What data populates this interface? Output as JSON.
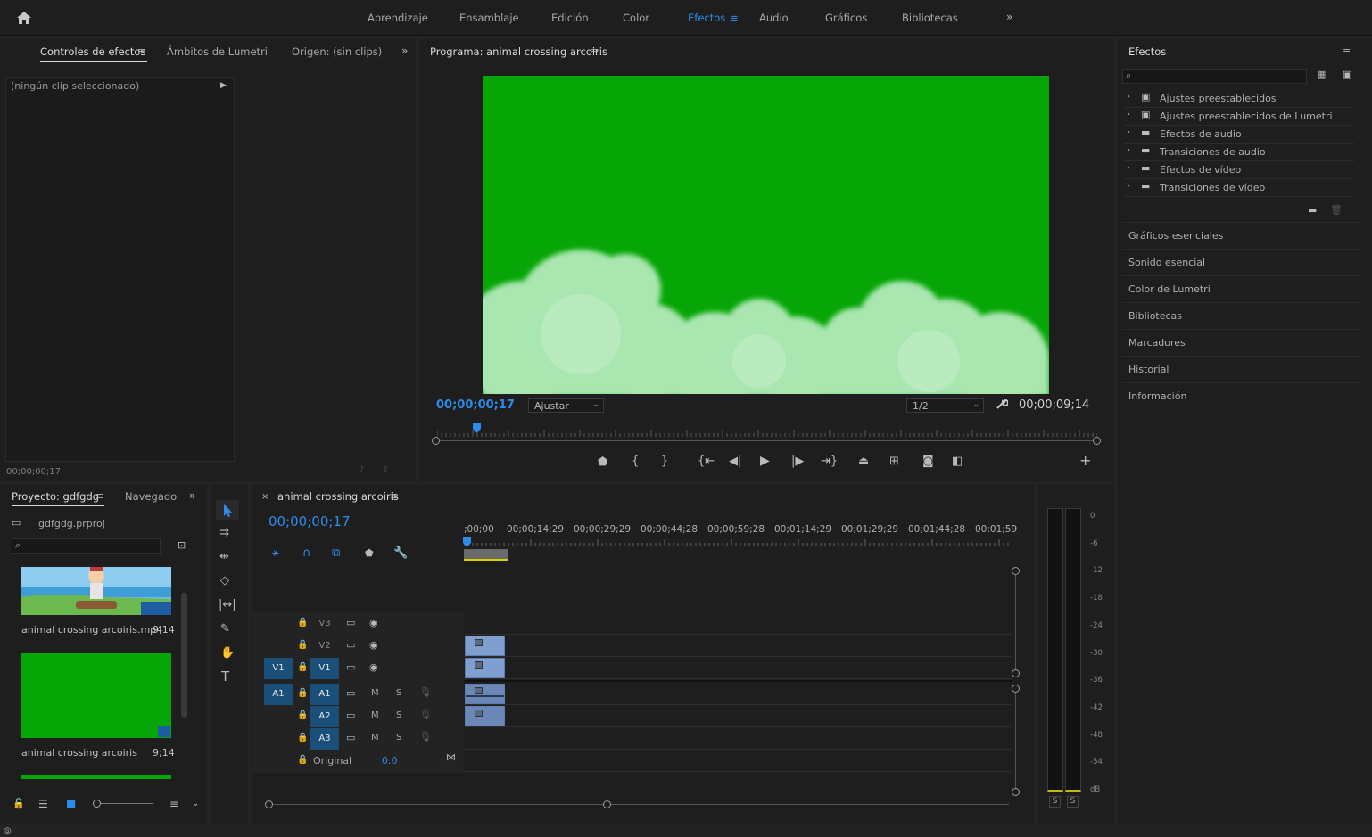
{
  "workspaces": {
    "items": [
      "Aprendizaje",
      "Ensamblaje",
      "Edición",
      "Color",
      "Efectos",
      "Audio",
      "Gráficos",
      "Bibliotecas"
    ],
    "active": "Efectos"
  },
  "left_panel": {
    "tabs": [
      "Controles de efectos",
      "Ámbitos de Lumetri",
      "Origen: (sin clips)"
    ],
    "no_clip": "(ningún clip seleccionado)",
    "timecode": "00;00;00;17"
  },
  "program": {
    "title": "Programa: animal crossing arcoiris",
    "timecode": "00;00;00;17",
    "fit": "Ajustar",
    "resolution": "1/2",
    "duration": "00;00;09;14",
    "playhead_fraction": 0.06
  },
  "effects_panel": {
    "title": "Efectos",
    "search_placeholder": "",
    "items": [
      "Ajustes preestablecidos",
      "Ajustes preestablecidos de Lumetri",
      "Efectos de audio",
      "Transiciones de audio",
      "Efectos de vídeo",
      "Transiciones de vídeo"
    ],
    "sections": [
      "Gráficos esenciales",
      "Sonido esencial",
      "Color de Lumetri",
      "Bibliotecas",
      "Marcadores",
      "Historial",
      "Información"
    ]
  },
  "project": {
    "tab": "Proyecto: gdfgdg",
    "tab2": "Navegado",
    "file": "gdfgdg.prproj",
    "items": [
      {
        "name": "animal crossing arcoiris.mp4",
        "duration": "9;14"
      },
      {
        "name": "animal crossing arcoiris",
        "duration": "9;14"
      }
    ]
  },
  "timeline": {
    "tab": "animal crossing arcoiris",
    "timecode": "00;00;00;17",
    "ruler": [
      ";00;00",
      "00;00;14;29",
      "00;00;29;29",
      "00;00;44;28",
      "00;00;59;28",
      "00;01;14;29",
      "00;01;29;29",
      "00;01;44;28",
      "00;01;59"
    ],
    "video_tracks": [
      "V3",
      "V2",
      "V1"
    ],
    "audio_tracks": [
      "A1",
      "A2",
      "A3"
    ],
    "source_v": "V1",
    "source_a": "A1",
    "m_label": "M",
    "s_label": "S",
    "mix_label": "Original",
    "mix_value": "0.0"
  },
  "meter": {
    "labels": [
      "0",
      "-6",
      "-12",
      "-18",
      "-24",
      "-30",
      "-36",
      "-42",
      "-48",
      "-54",
      "dB"
    ],
    "solo": [
      "S",
      "S"
    ]
  },
  "colors": {
    "accent": "#2d8ceb",
    "greenscreen": "#05a605",
    "clip": "#7f9fd1"
  }
}
